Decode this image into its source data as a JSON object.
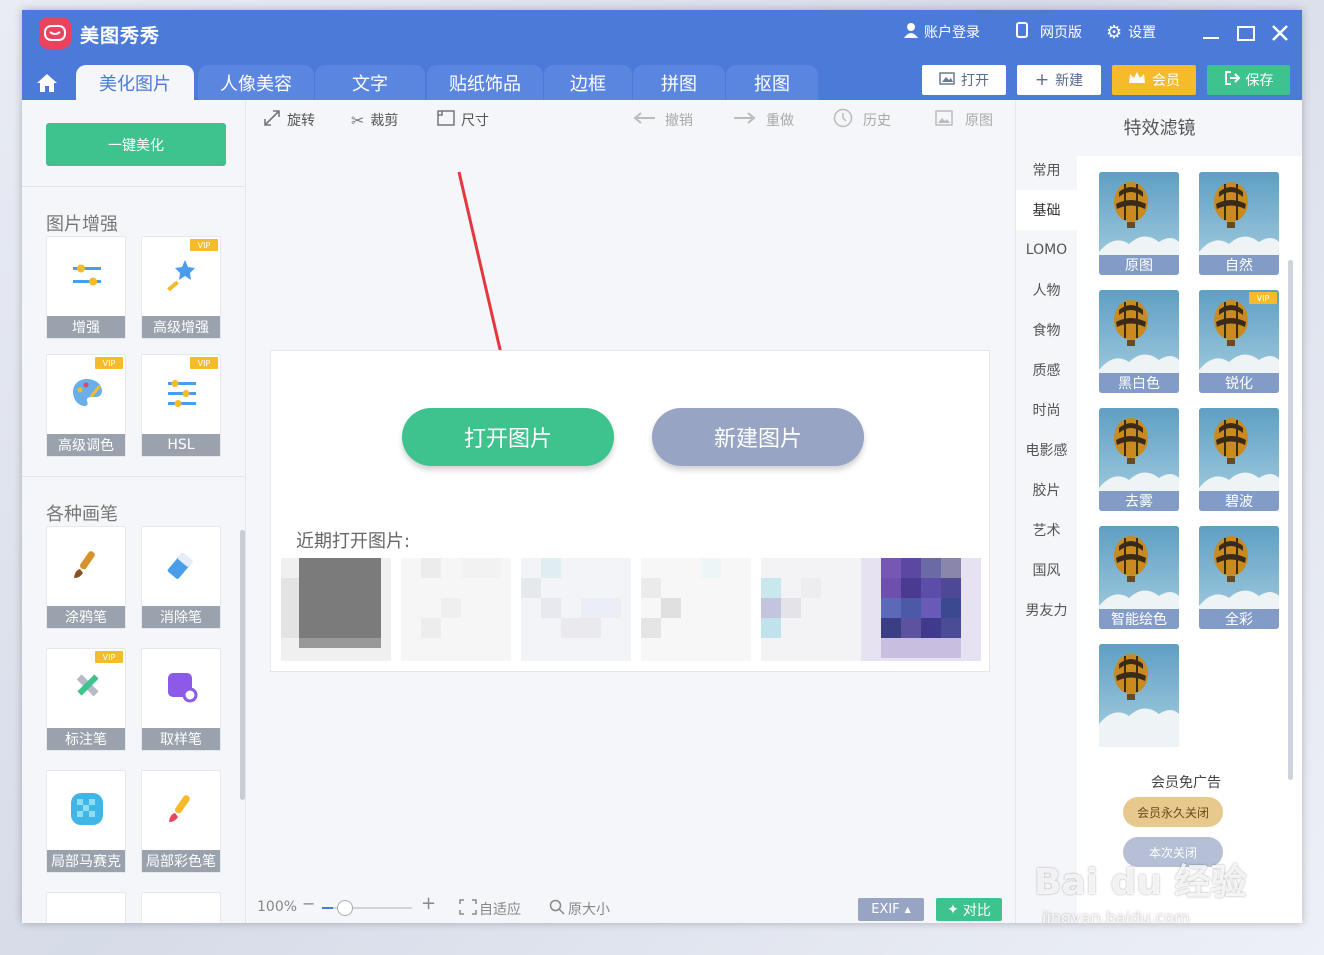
{
  "app": {
    "title": "美图秀秀"
  },
  "titlebar": {
    "login": "账户登录",
    "web": "网页版",
    "settings": "设置"
  },
  "tabs": [
    "美化图片",
    "人像美容",
    "文字",
    "贴纸饰品",
    "边框",
    "拼图",
    "抠图"
  ],
  "actions": {
    "open": "打开",
    "new": "新建",
    "vip": "会员",
    "save": "保存"
  },
  "left": {
    "one_click": "一键美化",
    "section_enhance": "图片增强",
    "enhance_tools": [
      "增强",
      "高级增强",
      "高级调色",
      "HSL"
    ],
    "section_brush": "各种画笔",
    "brush_tools": [
      "涂鸦笔",
      "消除笔",
      "标注笔",
      "取样笔",
      "局部马赛克",
      "局部彩色笔"
    ],
    "vip_badge": "VIP"
  },
  "toolbar": {
    "rotate": "旋转",
    "crop": "裁剪",
    "size": "尺寸",
    "undo": "撤销",
    "redo": "重做",
    "history": "历史",
    "original": "原图"
  },
  "card": {
    "open_image": "打开图片",
    "new_image": "新建图片",
    "recent_label": "近期打开图片:"
  },
  "bottom": {
    "zoom": "100%",
    "zoom_level": 0.12,
    "fit": "自适应",
    "actual_size": "原大小",
    "exif": "EXIF",
    "compare": "对比"
  },
  "right": {
    "title": "特效滤镜",
    "categories": [
      "常用",
      "基础",
      "LOMO",
      "人物",
      "食物",
      "质感",
      "时尚",
      "电影感",
      "胶片",
      "艺术",
      "国风",
      "男友力"
    ],
    "filters": [
      "原图",
      "自然",
      "黑白色",
      "锐化",
      "去雾",
      "碧波",
      "智能绘色",
      "全彩",
      ""
    ],
    "ad_text": "会员免广告",
    "ad_btn": "会员永久关闭",
    "ad_btn2": "本次关闭"
  },
  "watermark": {
    "brand": "Bai du 经验",
    "url": "jingyan.baidu.com"
  },
  "colors": {
    "brand_blue": "#4c7ad8",
    "green": "#3ec38f",
    "gray_btn": "#97a4c4",
    "vip_gold": "#f6bb2a"
  }
}
